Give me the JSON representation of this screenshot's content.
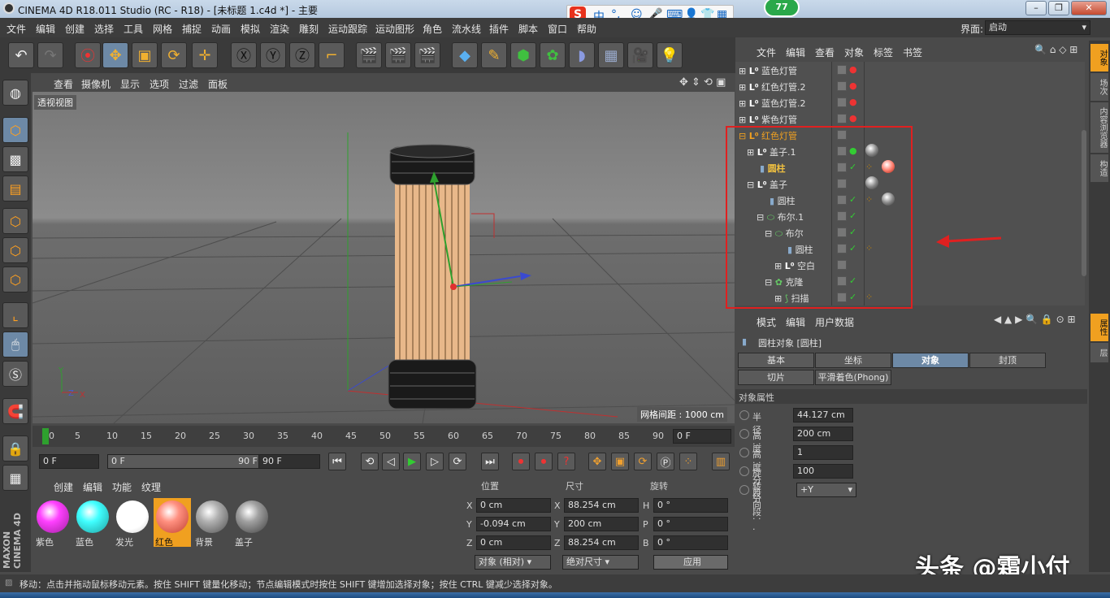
{
  "window": {
    "title": "CINEMA 4D R18.011 Studio (RC - R18) - [未标题 1.c4d *] - 主要",
    "badge": "77"
  },
  "ime": {
    "items": [
      "中",
      "°,",
      "☺",
      "🎤",
      "⌨",
      "👤",
      "👕",
      "▦"
    ]
  },
  "menubar": {
    "items": [
      "文件",
      "编辑",
      "创建",
      "选择",
      "工具",
      "网格",
      "捕捉",
      "动画",
      "模拟",
      "渲染",
      "雕刻",
      "运动跟踪",
      "运动图形",
      "角色",
      "流水线",
      "插件",
      "脚本",
      "窗口",
      "帮助"
    ],
    "layout_label": "界面:",
    "layout_value": "启动"
  },
  "viewport": {
    "menu": [
      "查看",
      "摄像机",
      "显示",
      "选项",
      "过滤",
      "面板"
    ],
    "label": "透视视图",
    "grid_info": "网格间距 : 1000 cm"
  },
  "timeline": {
    "ticks": [
      "0",
      "5",
      "10",
      "15",
      "20",
      "25",
      "30",
      "35",
      "40",
      "45",
      "50",
      "55",
      "60",
      "65",
      "70",
      "75",
      "80",
      "85",
      "90"
    ],
    "current": "0 F"
  },
  "transport": {
    "start": "0 F",
    "range_start": "0 F",
    "range_end": "90 F",
    "end": "90 F"
  },
  "materials": {
    "menu": [
      "创建",
      "编辑",
      "功能",
      "纹理"
    ],
    "items": [
      {
        "label": "紫色",
        "color": "#ff40ff"
      },
      {
        "label": "蓝色",
        "color": "#40ffff"
      },
      {
        "label": "发光",
        "color": "#ffffff"
      },
      {
        "label": "红色",
        "color": "#ff9080"
      },
      {
        "label": "背景",
        "color": "#b0b0b0"
      },
      {
        "label": "盖子",
        "color": "#a0a0a0"
      }
    ]
  },
  "coords": {
    "headers": [
      "位置",
      "尺寸",
      "旋转"
    ],
    "rows": [
      {
        "axis": "X",
        "pos": "0 cm",
        "size_axis": "X",
        "size": "88.254 cm",
        "rot_axis": "H",
        "rot": "0 °"
      },
      {
        "axis": "Y",
        "pos": "-0.094 cm",
        "size_axis": "Y",
        "size": "200 cm",
        "rot_axis": "P",
        "rot": "0 °"
      },
      {
        "axis": "Z",
        "pos": "0 cm",
        "size_axis": "Z",
        "size": "88.254 cm",
        "rot_axis": "B",
        "rot": "0 °"
      }
    ],
    "mode": "对象 (相对)",
    "size_mode": "绝对尺寸",
    "apply": "应用"
  },
  "objects": {
    "menu": [
      "文件",
      "编辑",
      "查看",
      "对象",
      "标签",
      "书签"
    ],
    "rows": [
      {
        "name": "蓝色灯管"
      },
      {
        "name": "红色灯管.2"
      },
      {
        "name": "蓝色灯管.2"
      },
      {
        "name": "紫色灯管"
      },
      {
        "name": "红色灯管"
      },
      {
        "name": "盖子.1"
      },
      {
        "name": "圆柱"
      },
      {
        "name": "盖子"
      },
      {
        "name": "圆柱"
      },
      {
        "name": "布尔.1"
      },
      {
        "name": "布尔"
      },
      {
        "name": "圆柱"
      },
      {
        "name": "空白"
      },
      {
        "name": "克隆"
      },
      {
        "name": "扫描"
      }
    ]
  },
  "attributes": {
    "menu": [
      "模式",
      "编辑",
      "用户数据"
    ],
    "object_title": "圆柱对象 [圆柱]",
    "tabs": [
      "基本",
      "坐标",
      "对象",
      "封顶",
      "切片",
      "平滑着色(Phong)"
    ],
    "section": "对象属性",
    "props": [
      {
        "label": "半径 . . .",
        "value": "44.127 cm"
      },
      {
        "label": "高度 . . .",
        "value": "200 cm"
      },
      {
        "label": "高度分段",
        "value": "1"
      },
      {
        "label": "旋转分段",
        "value": "100"
      },
      {
        "label": "方向 . . .",
        "value": "+Y"
      }
    ]
  },
  "side_tabs": [
    "对象",
    "场次",
    "内容浏览器",
    "构造",
    "属性",
    "层"
  ],
  "status": "移动：点击并拖动鼠标移动元素。按住 SHIFT 键量化移动；节点编辑模式时按住 SHIFT 键增加选择对象；按住 CTRL 键减少选择对象。",
  "watermark": "头条 @霜小付",
  "brand": "MAXON CINEMA 4D"
}
